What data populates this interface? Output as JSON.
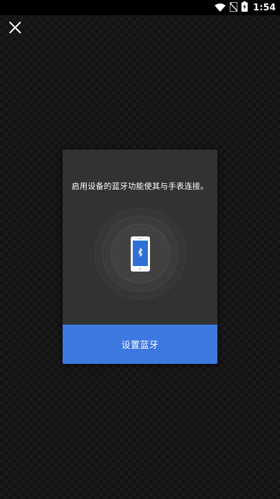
{
  "status_bar": {
    "time": "1:54",
    "icons": [
      "wifi-icon",
      "no-sim-icon",
      "battery-charging-icon"
    ]
  },
  "close_button": {
    "icon": "close-icon"
  },
  "dialog": {
    "message": "启用设备的蓝牙功能使其与手表连接。",
    "illustration": {
      "icon": "phone-bluetooth-icon",
      "accent_color": "#2f6fd8"
    },
    "action_button": {
      "label": "设置蓝牙",
      "color": "#3c78e0"
    }
  }
}
